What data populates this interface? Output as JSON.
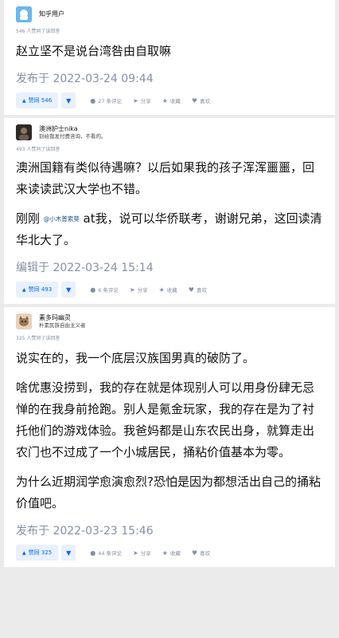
{
  "answers": [
    {
      "author": {
        "name": "知乎用户",
        "bio": ""
      },
      "upvote_info": "546 人赞同了该回答",
      "paragraphs": [
        "赵立坚不是说台湾咎由自取嘛"
      ],
      "timestamp": "发布于 2022-03-24 09:44",
      "actions": {
        "vote": "赞同 546",
        "comments": "27 条评论",
        "share": "分享",
        "collect": "收藏",
        "like": "喜欢"
      }
    },
    {
      "author": {
        "name": "澳洲护士nika",
        "bio": "别给我发付费咨询，不看的。"
      },
      "upvote_info": "493 人赞同了该回答",
      "paragraphs": [
        "澳洲国籍有类似待遇嘛？以后如果我的孩子浑浑噩噩，回来读读武汉大学也不错。"
      ],
      "p2": {
        "before": "刚刚 ",
        "mention": "@小木普索莫",
        "after": " at我，说可以华侨联考，谢谢兄弟，这回读清华北大了。"
      },
      "timestamp": "编辑于 2022-03-24 15:14",
      "actions": {
        "vote": "赞同 493",
        "comments": "6 条评论",
        "share": "分享",
        "collect": "收藏",
        "like": "喜欢"
      }
    },
    {
      "author": {
        "name": "素多玛幽灵",
        "bio": "朴素民族自由主义者"
      },
      "upvote_info": "325 人赞同了该回答",
      "paragraphs": [
        "说实在的，我一个底层汉族国男真的破防了。",
        "啥优惠没捞到，我的存在就是体现别人可以用身份肆无忌惮的在我身前抢跑。别人是氪金玩家，我的存在是为了衬托他们的游戏体验。我爸妈都是山东农民出身，就算走出农门也不过成了一个小城居民，捅粘价值基本为零。",
        "为什么近期润学愈演愈烈?恐怕是因为都想活出自己的捅粘价值吧。"
      ],
      "timestamp": "发布于 2022-03-23 15:46",
      "actions": {
        "vote": "赞同 325",
        "comments": "44 条评论",
        "share": "分享",
        "collect": "收藏",
        "like": "喜欢"
      }
    }
  ],
  "icons": {
    "vote": "▲",
    "down": "▼",
    "comment": "●",
    "share": "➤",
    "collect": "★",
    "like": "♥"
  },
  "colors": {
    "accent": "#0066ff",
    "vote_bg": "#e8f1fd",
    "meta": "#8590a6",
    "background": "#ebebeb"
  }
}
